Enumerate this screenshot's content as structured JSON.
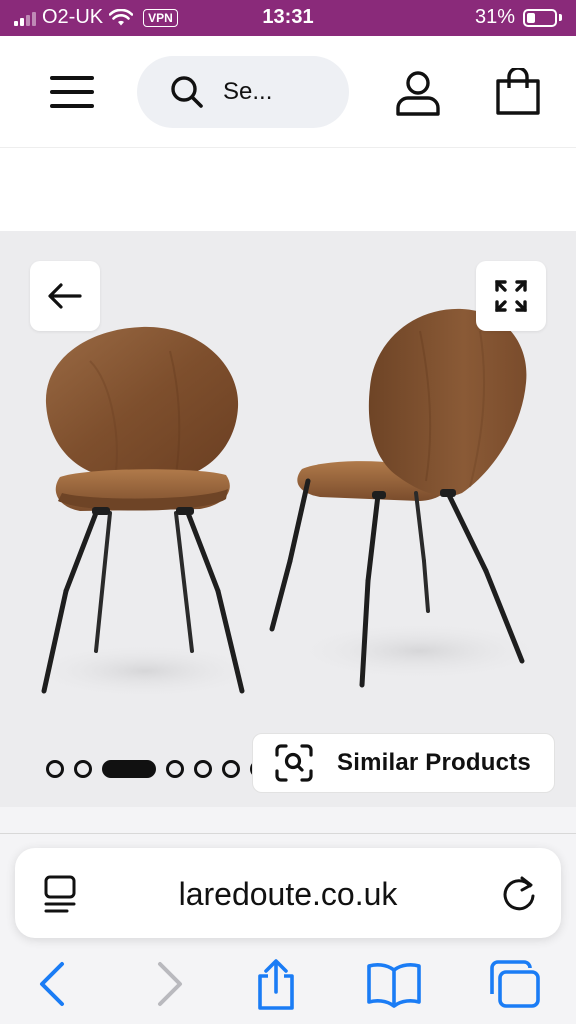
{
  "status_bar": {
    "carrier": "O2-UK",
    "vpn": "VPN",
    "time": "13:31",
    "battery": "31%"
  },
  "header": {
    "search_placeholder": "Se..."
  },
  "gallery": {
    "similar_products_label": "Similar Products",
    "image_count": 7,
    "active_image_index": 2
  },
  "browser": {
    "url": "laredoute.co.uk"
  },
  "colors": {
    "status_bar_bg": "#8a2a7a",
    "gallery_bg": "#ececee",
    "safari_blue": "#1a7cf5",
    "wood": "#8a5a36"
  },
  "icons": [
    "hamburger-menu-icon",
    "search-icon",
    "account-icon",
    "shopping-bag-icon",
    "arrow-left-icon",
    "expand-icon",
    "visual-search-icon",
    "reader-icon",
    "reload-icon",
    "back-icon",
    "forward-icon",
    "share-icon",
    "bookmarks-icon",
    "tabs-icon"
  ]
}
